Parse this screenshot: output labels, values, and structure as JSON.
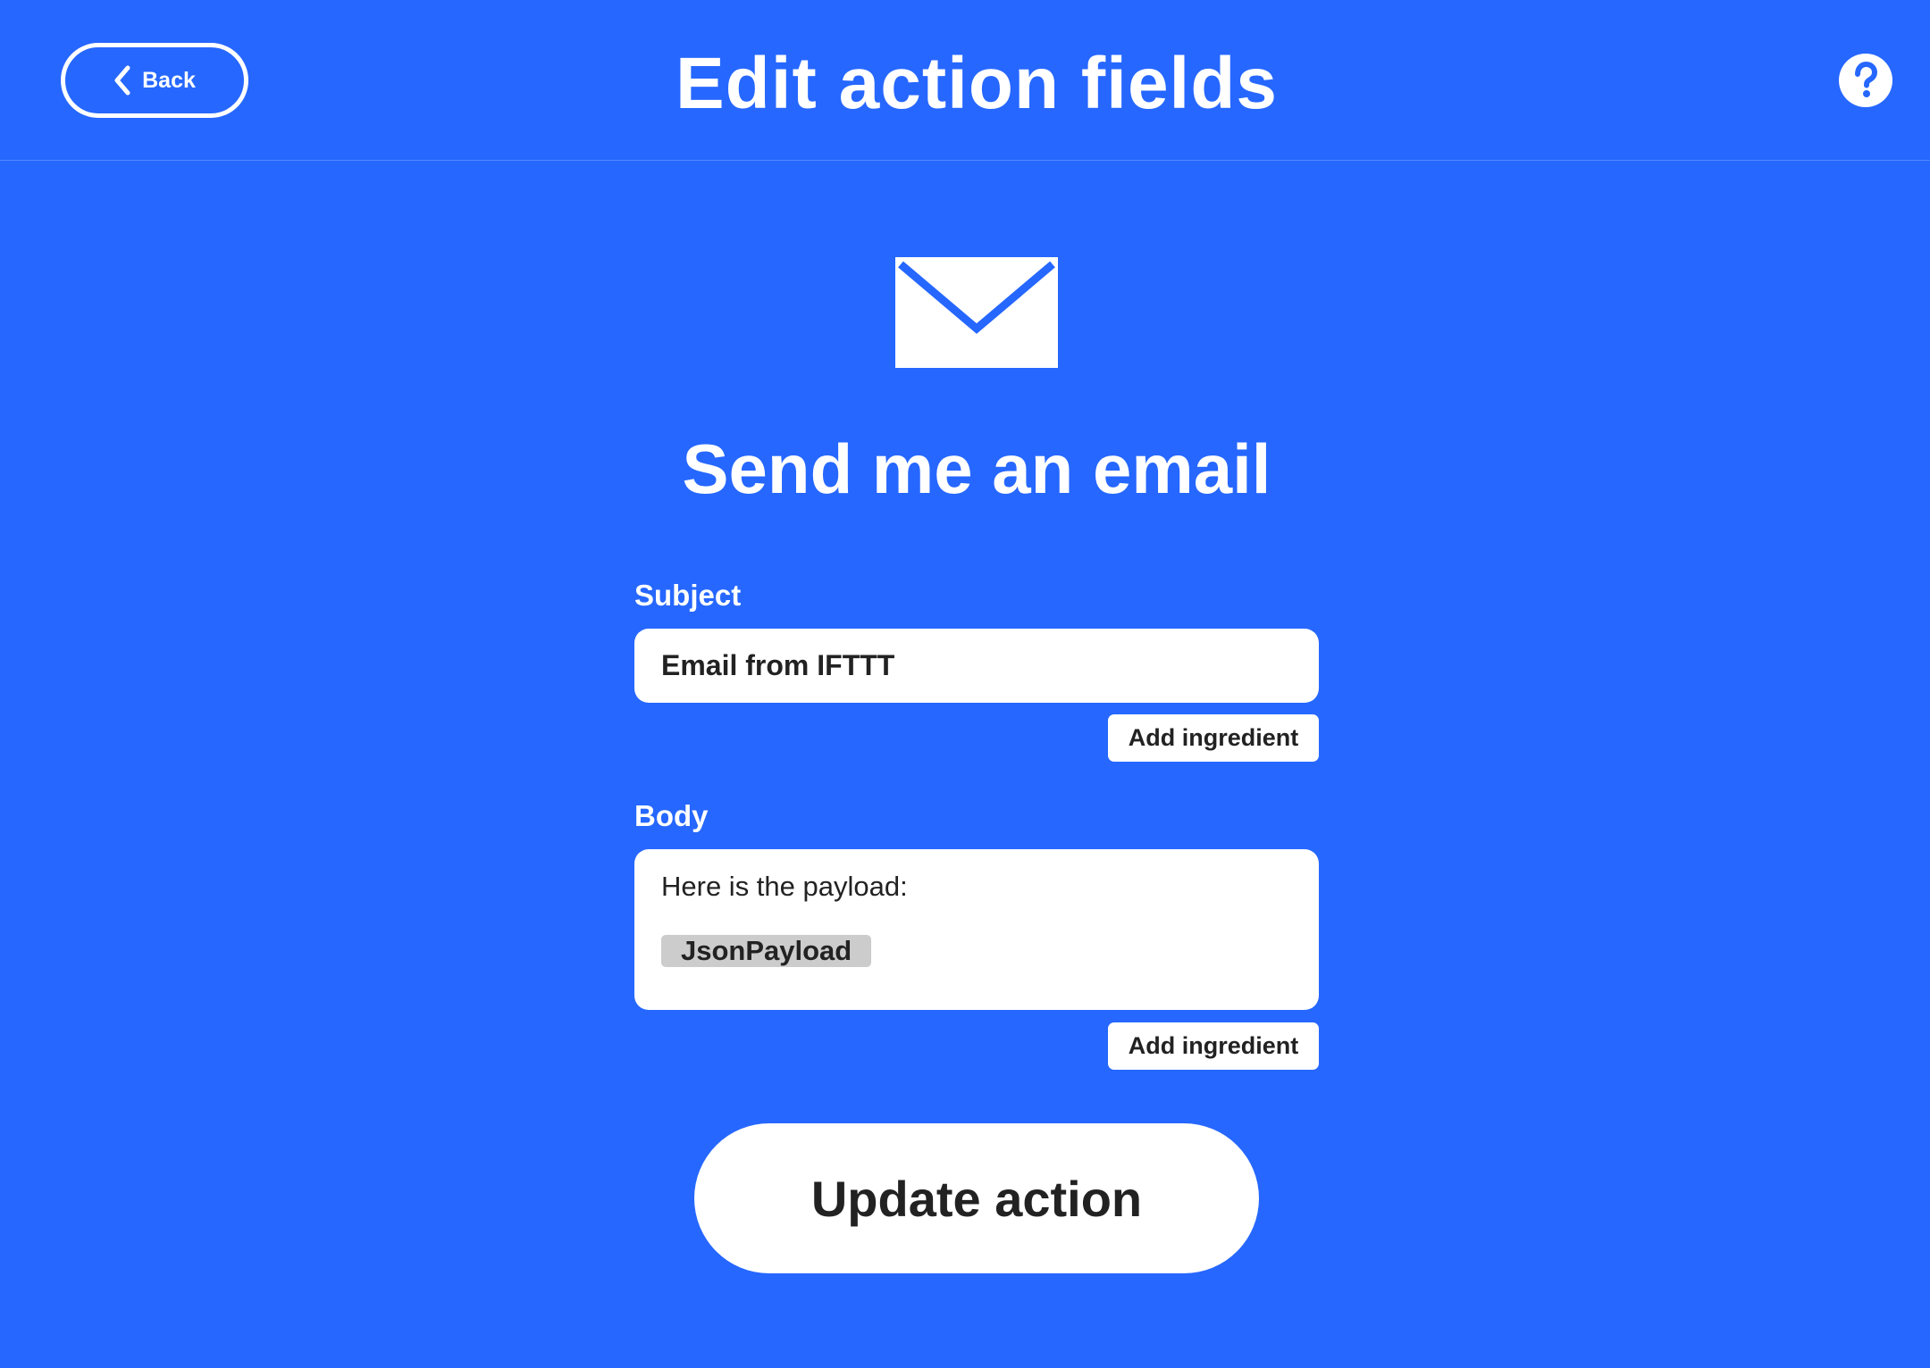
{
  "header": {
    "back_label": "Back",
    "title": "Edit action fields",
    "help_icon": "question-circle-icon"
  },
  "action": {
    "icon": "envelope-icon",
    "title": "Send me an email"
  },
  "fields": {
    "subject": {
      "label": "Subject",
      "value": "Email from IFTTT",
      "add_ingredient_label": "Add ingredient"
    },
    "body": {
      "label": "Body",
      "text": "Here is the payload:",
      "ingredient": "JsonPayload",
      "add_ingredient_label": "Add ingredient"
    }
  },
  "submit": {
    "label": "Update action"
  },
  "colors": {
    "background": "#2667FF",
    "text_on_background": "#FFFFFF",
    "input_background": "#FFFFFF",
    "input_text": "#222222",
    "ingredient_chip": "#CCCCCC"
  }
}
